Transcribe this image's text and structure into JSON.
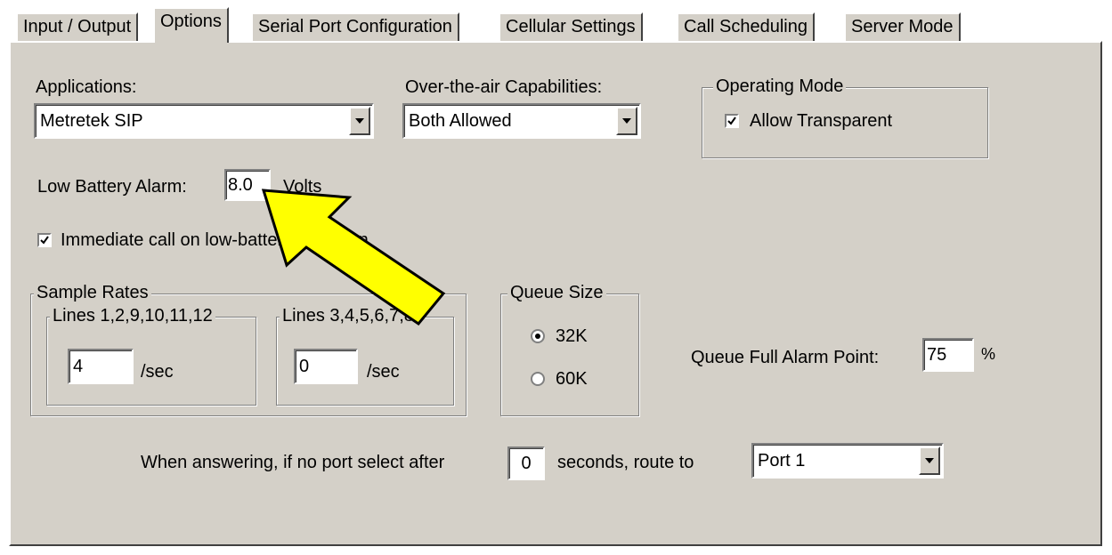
{
  "tabs": [
    {
      "label": "Input / Output"
    },
    {
      "label": "Options",
      "active": true
    },
    {
      "label": "Serial Port Configuration"
    },
    {
      "label": "Cellular Settings"
    },
    {
      "label": "Call Scheduling"
    },
    {
      "label": "Server Mode"
    }
  ],
  "applications": {
    "label": "Applications:",
    "value": "Metretek SIP"
  },
  "ota": {
    "label": "Over-the-air Capabilities:",
    "value": "Both Allowed"
  },
  "operating_mode": {
    "legend": "Operating Mode",
    "allow_transparent_label": "Allow Transparent",
    "allow_transparent_checked": true
  },
  "low_battery": {
    "label": "Low Battery Alarm:",
    "value": "8.0",
    "unit": "Volts"
  },
  "immediate_call": {
    "label": "Immediate call on low-battery condition",
    "checked": true
  },
  "sample_rates": {
    "legend": "Sample Rates",
    "group1": {
      "legend": "Lines 1,2,9,10,11,12",
      "value": "4",
      "unit": "/sec"
    },
    "group2": {
      "legend": "Lines 3,4,5,6,7,8",
      "value": "0",
      "unit": "/sec"
    }
  },
  "queue_size": {
    "legend": "Queue Size",
    "options": [
      "32K",
      "60K"
    ],
    "selected": "32K"
  },
  "queue_full": {
    "label": "Queue Full Alarm Point:",
    "value": "75",
    "unit": "%"
  },
  "answering": {
    "label_before": "When answering, if no port select after",
    "seconds": "0",
    "label_after": "seconds, route to",
    "port": "Port 1"
  },
  "colors": {
    "dialog_bg": "#d4d0c8",
    "arrow_fill": "#ffff00"
  }
}
